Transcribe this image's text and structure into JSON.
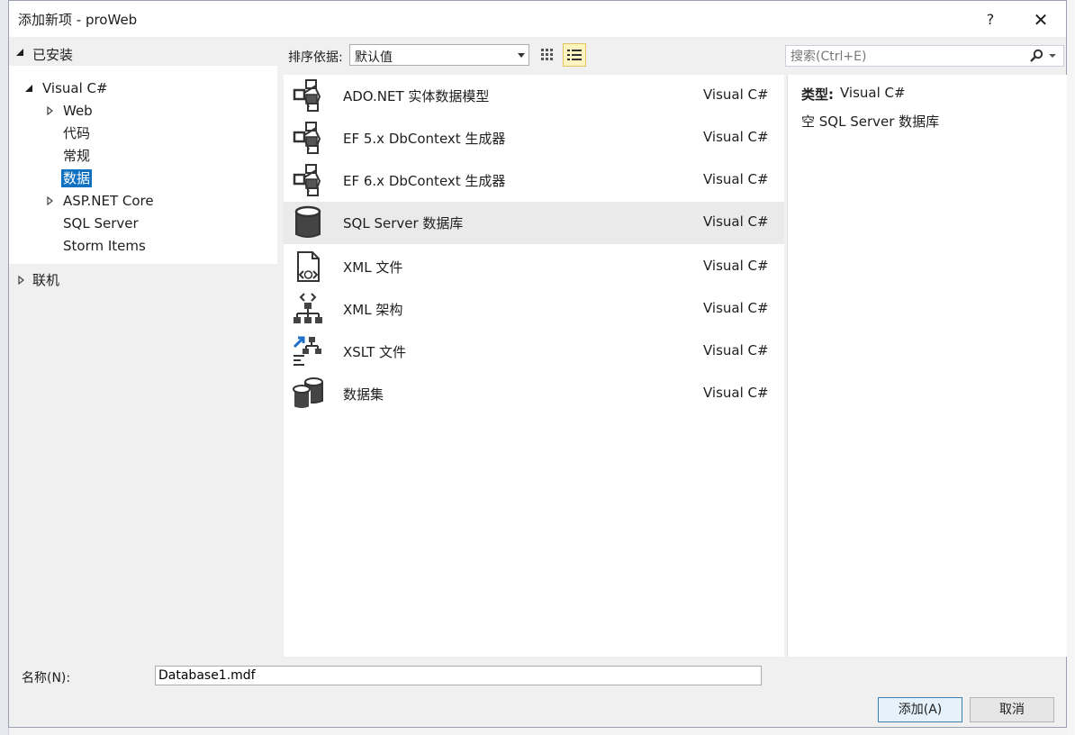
{
  "dialog": {
    "title": "添加新项 - proWeb",
    "help_label": "?",
    "close_label": "✕"
  },
  "tree": {
    "installed": "已安装",
    "visual_csharp": "Visual C#",
    "items": [
      {
        "label": "Web",
        "expandable": true
      },
      {
        "label": "代码",
        "expandable": false
      },
      {
        "label": "常规",
        "expandable": false
      },
      {
        "label": "数据",
        "expandable": false,
        "selected": true
      },
      {
        "label": "ASP.NET Core",
        "expandable": true
      },
      {
        "label": "SQL Server",
        "expandable": false
      },
      {
        "label": "Storm Items",
        "expandable": false
      }
    ],
    "online": "联机"
  },
  "toolbar": {
    "sort_label": "排序依据:",
    "sort_value": "默认值",
    "search_placeholder": "搜索(Ctrl+E)"
  },
  "templates": [
    {
      "name": "ADO.NET 实体数据模型",
      "lang": "Visual C#",
      "icon": "entity-model-icon"
    },
    {
      "name": "EF 5.x DbContext 生成器",
      "lang": "Visual C#",
      "icon": "dbcontext-generator-icon"
    },
    {
      "name": "EF 6.x DbContext 生成器",
      "lang": "Visual C#",
      "icon": "dbcontext-generator-icon"
    },
    {
      "name": "SQL Server 数据库",
      "lang": "Visual C#",
      "icon": "database-icon",
      "selected": true
    },
    {
      "name": "XML 文件",
      "lang": "Visual C#",
      "icon": "xml-file-icon"
    },
    {
      "name": "XML 架构",
      "lang": "Visual C#",
      "icon": "xml-schema-icon"
    },
    {
      "name": "XSLT 文件",
      "lang": "Visual C#",
      "icon": "xslt-file-icon"
    },
    {
      "name": "数据集",
      "lang": "Visual C#",
      "icon": "dataset-icon"
    }
  ],
  "details": {
    "type_label": "类型:",
    "type_value": "Visual C#",
    "description": "空 SQL Server 数据库"
  },
  "footer": {
    "name_label": "名称(N):",
    "name_value": "Database1.mdf",
    "add_label": "添加(A)",
    "cancel_label": "取消"
  },
  "colors": {
    "selection": "#0e70c0",
    "row_selected": "#eaeaeb",
    "view_toggle_active": "#fdf4bf",
    "background_top": "#2b3a67"
  }
}
